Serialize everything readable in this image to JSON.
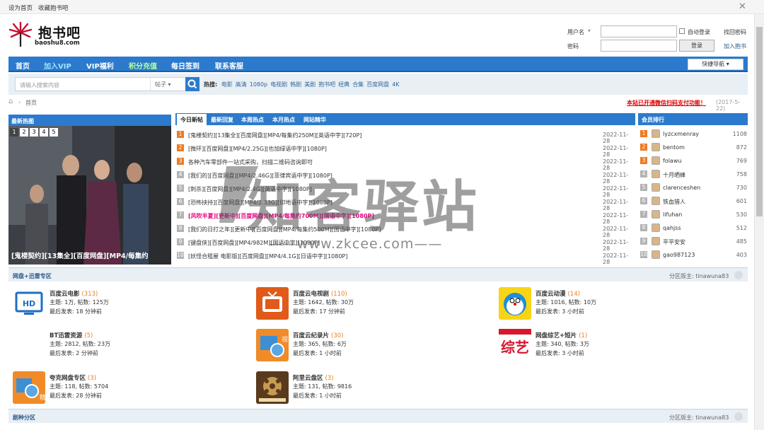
{
  "topbar": {
    "set_home": "设为首页",
    "bookmark": "收藏抱书吧"
  },
  "logo": {
    "name": "抱书吧",
    "domain": "baoshu8.com"
  },
  "login": {
    "username_label": "用户名",
    "auto_login": "自动登录",
    "find_pwd": "找回密码",
    "password_label": "密码",
    "login_btn": "登录",
    "join": "加入抱书"
  },
  "nav": {
    "items": [
      "首页",
      "加入VIP",
      "VIP福利",
      "积分充值",
      "每日签到",
      "联系客服"
    ],
    "quick_nav": "快捷导航"
  },
  "search": {
    "placeholder": "请输入搜索内容",
    "type": "帖子",
    "hot_label": "热搜:",
    "hot": [
      "电影",
      "高清",
      "1080p",
      "电视剧",
      "韩剧",
      "美剧",
      "抱书吧",
      "经典",
      "合集",
      "百度网盘",
      "4K"
    ]
  },
  "crumb": {
    "home": "首页",
    "notice": "本站已开通微信扫码支付功能！",
    "date": "(2017-5-22)"
  },
  "slide": {
    "title": "最新热图",
    "pages": [
      "1",
      "2",
      "3",
      "4",
      "5"
    ],
    "caption": "[鬼楼契约][13集全][百度网盘][MP4/每集约"
  },
  "news": {
    "tabs": [
      "今日新帖",
      "最新回复",
      "本周热点",
      "本月热点",
      "网站精华"
    ],
    "rows": [
      {
        "n": "1",
        "title": "[鬼楼契约][13集全][百度网盘][MP4/每集约250M][英语中字][720P]",
        "date": "2022-11-28"
      },
      {
        "n": "2",
        "title": "[微环][百度网盘][MP4/2.25G][也加绿语中字][1080P]",
        "date": "2022-11-28"
      },
      {
        "n": "3",
        "title": "各种汽车零部件一站式采购，扫描二维码咨询即可",
        "date": "2022-11-28"
      },
      {
        "n": "4",
        "title": "[我们的][百度网盘][MP4/2.46G][菲律宾语中字][1080P]",
        "date": "2022-11-28"
      },
      {
        "n": "5",
        "title": "[刺杀][百度网盘][MP4/2.4G][英语中字][1080P]",
        "date": "2022-11-28"
      },
      {
        "n": "6",
        "title": "[恐怖挟持][百度网盘][MP4/2.33G][印地语中字][1080P]",
        "date": "2022-11-28"
      },
      {
        "n": "7",
        "title": "[风吹半夏][更新中][百度网盘][MP4/每集约700M][国语中字][1080P]",
        "date": "2022-11-28",
        "hot": true
      },
      {
        "n": "8",
        "title": "[我们的日打之年][更新中][百度网盘][MP4/每集约500M][国语中字][1080P]",
        "date": "2022-11-28"
      },
      {
        "n": "9",
        "title": "[键盘侠][百度网盘][MP4/982M][国语中字][1080P]",
        "date": "2022-11-28"
      },
      {
        "n": "10",
        "title": "[妖怪合租屋 电影版][百度网盘][MP4/4.1G][日语中字][1080P]",
        "date": "2022-11-28"
      }
    ]
  },
  "rank": {
    "title": "会员排行",
    "rows": [
      {
        "n": "1",
        "user": "lyzcxmenray",
        "count": "1108"
      },
      {
        "n": "2",
        "user": "bentom",
        "count": "872"
      },
      {
        "n": "3",
        "user": "folawu",
        "count": "769"
      },
      {
        "n": "4",
        "user": "十月晒蜂",
        "count": "758"
      },
      {
        "n": "5",
        "user": "clarenceshen",
        "count": "730"
      },
      {
        "n": "6",
        "user": "铁血猎人",
        "count": "601"
      },
      {
        "n": "7",
        "user": "lifuhan",
        "count": "530"
      },
      {
        "n": "8",
        "user": "qahjss",
        "count": "512"
      },
      {
        "n": "9",
        "user": "平平安安",
        "count": "485"
      },
      {
        "n": "10",
        "user": "gao987123",
        "count": "403"
      }
    ]
  },
  "section1": {
    "title": "网盘+迅雷专区",
    "moderator": "分区版主: tinawuna83"
  },
  "forums": [
    {
      "name": "百度云电影",
      "count": "(313)",
      "stats": "主题: 1万, 帖数: 125万",
      "last": "最后发表: 18 分钟前"
    },
    {
      "name": "百度云电视剧",
      "count": "(110)",
      "stats": "主题: 1642, 帖数: 30万",
      "last": "最后发表: 17 分钟前"
    },
    {
      "name": "百度云动漫",
      "count": "(14)",
      "stats": "主题: 1016, 帖数: 10万",
      "last": "最后发表: 3 小时前"
    },
    {
      "name": "BT迅雷资源",
      "count": "(5)",
      "stats": "主题: 2812, 帖数: 23万",
      "last": "最后发表: 2 分钟前"
    },
    {
      "name": "百度云纪录片",
      "count": "(30)",
      "stats": "主题: 365, 帖数: 6万",
      "last": "最后发表: 1 小时前"
    },
    {
      "name": "网盘综艺+短片",
      "count": "(1)",
      "stats": "主题: 340, 帖数: 3万",
      "last": "最后发表: 3 小时前"
    },
    {
      "name": "夸克网盘专区",
      "count": "(3)",
      "stats": "主题: 118, 帖数: 5704",
      "last": "最后发表: 28 分钟前"
    },
    {
      "name": "阿里云盘区",
      "count": "(3)",
      "stats": "主题: 131, 帖数: 9816",
      "last": "最后发表: 1 小时前"
    }
  ],
  "section2": {
    "title": "剧种分区",
    "moderator": "分区版主: tinawuna83"
  },
  "watermark": {
    "brand": "知客驿站",
    "url": "www.zkcee.com"
  },
  "colors": {
    "nav": "#2b7acd",
    "accent": "#ef7b21",
    "hot": "#e4007f",
    "notice": "#dd0000"
  }
}
